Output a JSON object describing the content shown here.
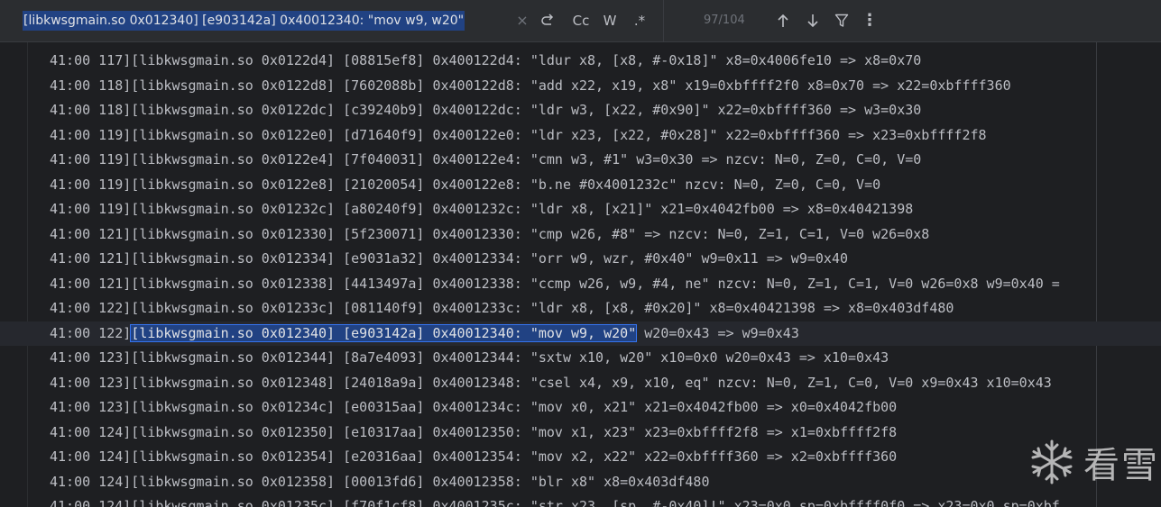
{
  "search": {
    "query": "[libkwsgmain.so 0x012340] [e903142a] 0x40012340: \"mov w9, w20\"",
    "clear_icon": "close-icon",
    "match_case_label": "Cc",
    "whole_words_label": "W",
    "regex_label": ".*",
    "match_count": "97/104"
  },
  "toolbar_icons": {
    "replace": "replace-icon",
    "prev": "arrow-up-icon",
    "next": "arrow-down-icon",
    "filter": "filter-icon",
    "more": "more-vertical-icon"
  },
  "colors": {
    "editor_bg": "#1e1f22",
    "toolbar_bg": "#2b2d30",
    "selection_bg": "#214283",
    "selection_border": "#3574f0",
    "text": "#bcbec4"
  },
  "lines": [
    {
      "prefix": "41:00 117][libkwsgmain.so 0x0122d4] [08815ef8] 0x400122d4: \"ldur x8, [x8, #-0x18]\" x8=0x4006fe10 => x8=0x70",
      "match": "",
      "suffix": ""
    },
    {
      "prefix": "41:00 118][libkwsgmain.so 0x0122d8] [7602088b] 0x400122d8: \"add x22, x19, x8\" x19=0xbffff2f0 x8=0x70 => x22=0xbffff360",
      "match": "",
      "suffix": ""
    },
    {
      "prefix": "41:00 118][libkwsgmain.so 0x0122dc] [c39240b9] 0x400122dc: \"ldr w3, [x22, #0x90]\" x22=0xbffff360 => w3=0x30",
      "match": "",
      "suffix": ""
    },
    {
      "prefix": "41:00 119][libkwsgmain.so 0x0122e0] [d71640f9] 0x400122e0: \"ldr x23, [x22, #0x28]\" x22=0xbffff360 => x23=0xbffff2f8",
      "match": "",
      "suffix": ""
    },
    {
      "prefix": "41:00 119][libkwsgmain.so 0x0122e4] [7f040031] 0x400122e4: \"cmn w3, #1\" w3=0x30 => nzcv: N=0, Z=0, C=0, V=0",
      "match": "",
      "suffix": ""
    },
    {
      "prefix": "41:00 119][libkwsgmain.so 0x0122e8] [21020054] 0x400122e8: \"b.ne #0x4001232c\" nzcv: N=0, Z=0, C=0, V=0",
      "match": "",
      "suffix": ""
    },
    {
      "prefix": "41:00 119][libkwsgmain.so 0x01232c] [a80240f9] 0x4001232c: \"ldr x8, [x21]\" x21=0x4042fb00 => x8=0x40421398",
      "match": "",
      "suffix": ""
    },
    {
      "prefix": "41:00 121][libkwsgmain.so 0x012330] [5f230071] 0x40012330: \"cmp w26, #8\" => nzcv: N=0, Z=1, C=1, V=0 w26=0x8",
      "match": "",
      "suffix": ""
    },
    {
      "prefix": "41:00 121][libkwsgmain.so 0x012334] [e9031a32] 0x40012334: \"orr w9, wzr, #0x40\" w9=0x11 => w9=0x40",
      "match": "",
      "suffix": ""
    },
    {
      "prefix": "41:00 121][libkwsgmain.so 0x012338] [4413497a] 0x40012338: \"ccmp w26, w9, #4, ne\" nzcv: N=0, Z=1, C=1, V=0 w26=0x8 w9=0x40 =",
      "match": "",
      "suffix": ""
    },
    {
      "prefix": "41:00 122][libkwsgmain.so 0x01233c] [081140f9] 0x4001233c: \"ldr x8, [x8, #0x20]\" x8=0x40421398 => x8=0x403df480",
      "match": "",
      "suffix": ""
    },
    {
      "prefix": "41:00 122]",
      "match": "[libkwsgmain.so 0x012340] [e903142a] 0x40012340: \"mov w9, w20\"",
      "suffix": " w20=0x43 => w9=0x43"
    },
    {
      "prefix": "41:00 123][libkwsgmain.so 0x012344] [8a7e4093] 0x40012344: \"sxtw x10, w20\" x10=0x0 w20=0x43 => x10=0x43",
      "match": "",
      "suffix": ""
    },
    {
      "prefix": "41:00 123][libkwsgmain.so 0x012348] [24018a9a] 0x40012348: \"csel x4, x9, x10, eq\" nzcv: N=0, Z=1, C=0, V=0 x9=0x43 x10=0x43",
      "match": "",
      "suffix": ""
    },
    {
      "prefix": "41:00 123][libkwsgmain.so 0x01234c] [e00315aa] 0x4001234c: \"mov x0, x21\" x21=0x4042fb00 => x0=0x4042fb00",
      "match": "",
      "suffix": ""
    },
    {
      "prefix": "41:00 124][libkwsgmain.so 0x012350] [e10317aa] 0x40012350: \"mov x1, x23\" x23=0xbffff2f8 => x1=0xbffff2f8",
      "match": "",
      "suffix": ""
    },
    {
      "prefix": "41:00 124][libkwsgmain.so 0x012354] [e20316aa] 0x40012354: \"mov x2, x22\" x22=0xbffff360 => x2=0xbffff360",
      "match": "",
      "suffix": ""
    },
    {
      "prefix": "41:00 124][libkwsgmain.so 0x012358] [00013fd6] 0x40012358: \"blr x8\" x8=0x403df480",
      "match": "",
      "suffix": ""
    },
    {
      "prefix": "41:00 124][libkwsgmain.so 0x01235c] [f70f1cf8] 0x4001235c: \"str x23, [sp, #-0x40]!\" x23=0x0 sp=0xbffff0f0 => x23=0x0 sp=0xbf",
      "match": "",
      "suffix": ""
    }
  ],
  "watermark": {
    "icon": "snowflake-icon",
    "text": "看雪"
  }
}
